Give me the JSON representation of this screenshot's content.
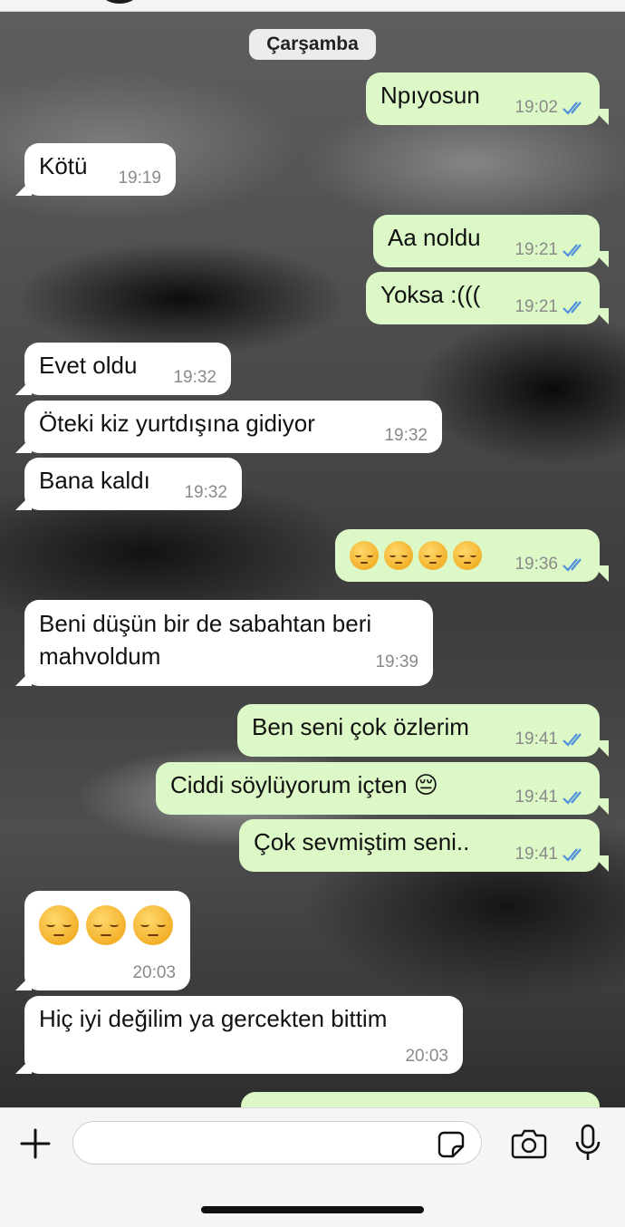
{
  "date_separator": "Çarşamba",
  "messages": [
    {
      "dir": "out",
      "text": "Npıyosun",
      "time": "19:02"
    },
    {
      "dir": "in",
      "text": "Kötü",
      "time": "19:19"
    },
    {
      "dir": "out",
      "text": "Aa noldu",
      "time": "19:21"
    },
    {
      "dir": "out",
      "text": "Yoksa :(((",
      "time": "19:21"
    },
    {
      "dir": "in",
      "text": "Evet oldu",
      "time": "19:32"
    },
    {
      "dir": "in",
      "text": "Öteki kiz yurtdışına gidiyor",
      "time": "19:32"
    },
    {
      "dir": "in",
      "text": "Bana kaldı",
      "time": "19:32"
    },
    {
      "dir": "out",
      "text": "😔😔😔😔",
      "time": "19:36"
    },
    {
      "dir": "in",
      "line1": "Beni düşün bir de sabahtan beri",
      "line2": "mahvoldum",
      "time": "19:39"
    },
    {
      "dir": "out",
      "text": "Ben seni çok özlerim",
      "time": "19:41"
    },
    {
      "dir": "out",
      "text": "Ciddi söylüyorum içten 😔",
      "time": "19:41"
    },
    {
      "dir": "out",
      "text": "Çok sevmiştim seni..",
      "time": "19:41"
    },
    {
      "dir": "in",
      "text": "😔😔😔",
      "time": "20:03"
    },
    {
      "dir": "in",
      "text": "Hiç iyi değilim ya gercekten bittim",
      "time": "20:03"
    }
  ],
  "composer": {
    "input_value": "",
    "icons": [
      "plus-icon",
      "sticker-icon",
      "camera-icon",
      "microphone-icon"
    ]
  },
  "colors": {
    "outgoing_bubble": "#dcf8c6",
    "incoming_bubble": "#ffffff",
    "read_ticks": "#4f8fdc"
  }
}
